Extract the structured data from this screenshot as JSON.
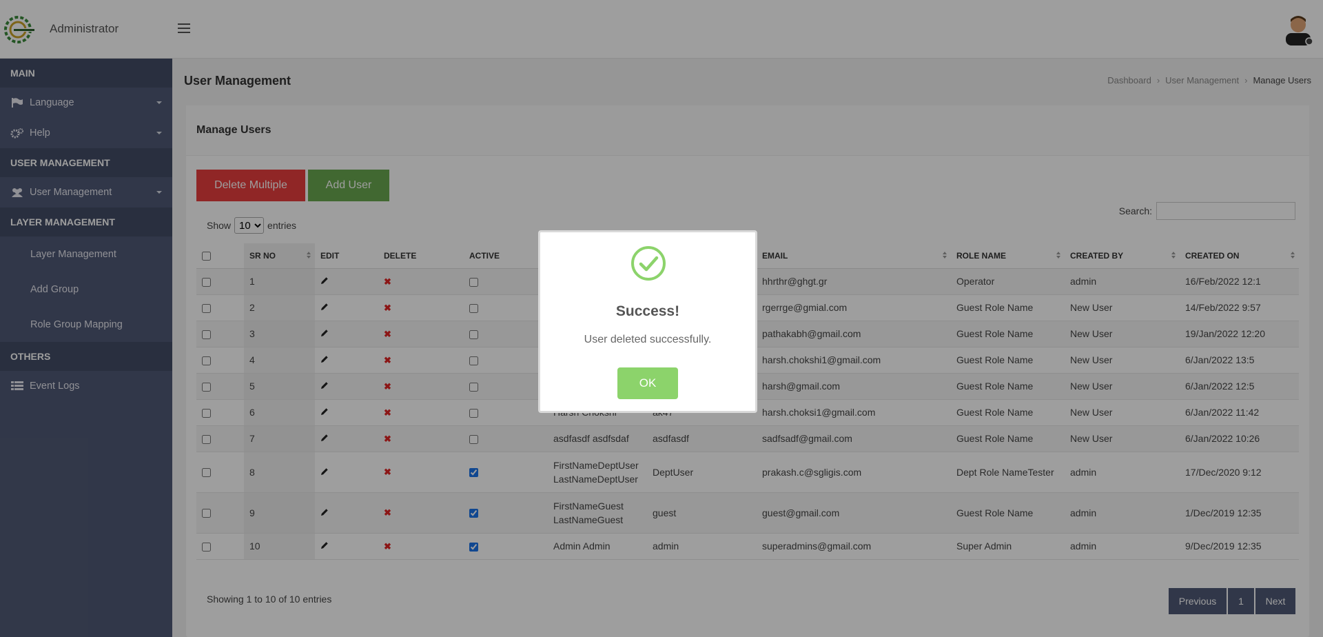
{
  "app": {
    "title": "Administrator"
  },
  "sidebar": {
    "sections": [
      {
        "label": "MAIN"
      },
      {
        "label": "USER MANAGEMENT"
      },
      {
        "label": "LAYER MANAGEMENT"
      },
      {
        "label": "OTHERS"
      }
    ],
    "items": {
      "language": "Language",
      "help": "Help",
      "user_management": "User Management",
      "layer_management": "Layer Management",
      "add_group": "Add Group",
      "role_group_mapping": "Role Group Mapping",
      "event_logs": "Event Logs"
    }
  },
  "page": {
    "title": "User Management",
    "breadcrumb": [
      "Dashboard",
      "User Management",
      "Manage Users"
    ],
    "card_title": "Manage Users",
    "delete_multiple_label": "Delete Multiple",
    "add_user_label": "Add User",
    "show_label": "Show",
    "entries_label": "entries",
    "page_size": "10",
    "search_label": "Search:",
    "footer_info": "Showing 1 to 10 of 10 entries",
    "pagination": {
      "previous": "Previous",
      "current": "1",
      "next": "Next"
    }
  },
  "table": {
    "headers": {
      "sr_no": "SR NO",
      "edit": "EDIT",
      "delete": "DELETE",
      "active": "ACTIVE",
      "email": "EMAIL",
      "role_name": "ROLE NAME",
      "created_by": "CREATED BY",
      "created_on": "CREATED ON"
    },
    "rows": [
      {
        "sr": "1",
        "active": false,
        "name": "",
        "username": "",
        "email": "hhrthr@ghgt.gr",
        "role": "Operator",
        "created_by": "admin",
        "created_on": "16/Feb/2022 12:1"
      },
      {
        "sr": "2",
        "active": false,
        "name": "",
        "username": "",
        "email": "rgerrge@gmial.com",
        "role": "Guest Role Name",
        "created_by": "New User",
        "created_on": "14/Feb/2022 9:57"
      },
      {
        "sr": "3",
        "active": false,
        "name": "",
        "username": "",
        "email": "pathakabh@gmail.com",
        "role": "Guest Role Name",
        "created_by": "New User",
        "created_on": "19/Jan/2022 12:20"
      },
      {
        "sr": "4",
        "active": false,
        "name": "",
        "username": "",
        "email": "harsh.chokshi1@gmail.com",
        "role": "Guest Role Name",
        "created_by": "New User",
        "created_on": "6/Jan/2022 13:5"
      },
      {
        "sr": "5",
        "active": false,
        "name": "",
        "username": "",
        "email": "harsh@gmail.com",
        "role": "Guest Role Name",
        "created_by": "New User",
        "created_on": "6/Jan/2022 12:5"
      },
      {
        "sr": "6",
        "active": false,
        "name": "Harsh Chokshi",
        "username": "ak47",
        "email": "harsh.choksi1@gmail.com",
        "role": "Guest Role Name",
        "created_by": "New User",
        "created_on": "6/Jan/2022 11:42"
      },
      {
        "sr": "7",
        "active": false,
        "name": "asdfasdf asdfsdaf",
        "username": "asdfasdf",
        "email": "sadfsadf@gmail.com",
        "role": "Guest Role Name",
        "created_by": "New User",
        "created_on": "6/Jan/2022 10:26"
      },
      {
        "sr": "8",
        "active": true,
        "name_line1": "FirstNameDeptUser",
        "name_line2": "LastNameDeptUser",
        "username": "DeptUser",
        "email": "prakash.c@sgligis.com",
        "role": "Dept Role NameTester",
        "created_by": "admin",
        "created_on": "17/Dec/2020 9:12"
      },
      {
        "sr": "9",
        "active": true,
        "name_line1": "FirstNameGuest",
        "name_line2": "LastNameGuest",
        "username": "guest",
        "email": "guest@gmail.com",
        "role": "Guest Role Name",
        "created_by": "admin",
        "created_on": "1/Dec/2019 12:35"
      },
      {
        "sr": "10",
        "active": true,
        "name": "Admin Admin",
        "username": "admin",
        "email": "superadmins@gmail.com",
        "role": "Super Admin",
        "created_by": "admin",
        "created_on": "9/Dec/2019 12:35"
      }
    ]
  },
  "modal": {
    "title": "Success!",
    "message": "User deleted successfully.",
    "ok_label": "OK"
  },
  "colors": {
    "sidebar_bg": "#505a76",
    "sidebar_section_bg": "#434c66",
    "delete_button": "#e83e3e",
    "add_button": "#6aa84f",
    "success_green": "#8cd36b",
    "pagination_bg": "#505a76"
  },
  "icons": {
    "logo": "dehradun-smart-city-logo",
    "menu": "hamburger-icon",
    "avatar": "user-avatar",
    "language": "flag-icon",
    "help": "gears-icon",
    "user_management": "users-icon",
    "event_logs": "list-icon",
    "edit": "pencil-icon",
    "delete": "x-icon",
    "success": "check-circle-icon"
  }
}
